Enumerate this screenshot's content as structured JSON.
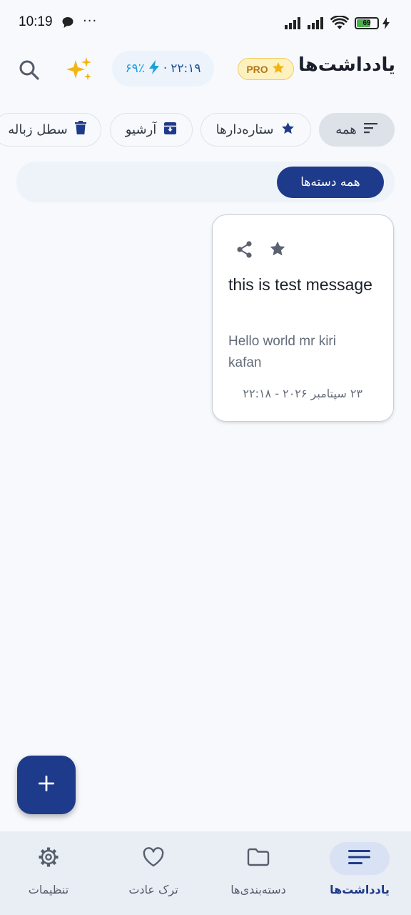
{
  "status_bar": {
    "time": "10:19",
    "more": "···",
    "battery_level": "69",
    "battery_fraction": 0.69
  },
  "header": {
    "title": "یادداشت‌ها",
    "pro_label": "PRO",
    "timer_time": "۲۲:۱۹",
    "timer_separator": "·",
    "timer_percent": "۶۹٪",
    "colors": {
      "pro_bg": "#fdf1bf",
      "pro_text": "#b2781a",
      "sparkle": "#f2b516",
      "timer_accent": "#1aa0d8"
    }
  },
  "filters": [
    {
      "label": "همه",
      "icon": "sort-lines-icon",
      "active": true
    },
    {
      "label": "ستاره‌دارها",
      "icon": "star-icon",
      "active": false
    },
    {
      "label": "آرشیو",
      "icon": "archive-icon",
      "active": false
    },
    {
      "label": "سطل زباله",
      "icon": "trash-icon",
      "active": false
    }
  ],
  "categories": {
    "selected": "همه دسته‌ها"
  },
  "notes": [
    {
      "title": "this is test message",
      "body": "Hello world mr kiri kafan",
      "date": "۲۳ سپتامبر ۲۰۲۶ - ۲۲:۱۸"
    }
  ],
  "fab": {
    "icon": "plus-icon"
  },
  "bottom_nav": [
    {
      "label": "یادداشت‌ها",
      "icon": "notes-lines-icon",
      "active": true
    },
    {
      "label": "دسته‌بندی‌ها",
      "icon": "folder-icon",
      "active": false
    },
    {
      "label": "ترک عادت",
      "icon": "heart-icon",
      "active": false
    },
    {
      "label": "تنظیمات",
      "icon": "gear-icon",
      "active": false
    }
  ],
  "theme": {
    "primary": "#1e3a8a",
    "background": "#f7f9fc"
  }
}
